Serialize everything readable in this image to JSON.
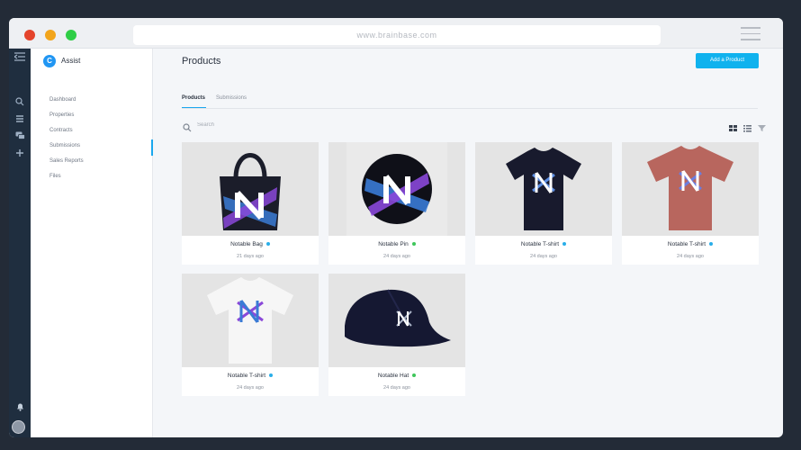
{
  "browser": {
    "url": "www.brainbase.com"
  },
  "app": {
    "name": "Assist",
    "logo_letter": "C"
  },
  "sidebar": {
    "items": [
      {
        "label": "Dashboard"
      },
      {
        "label": "Properties"
      },
      {
        "label": "Contracts"
      },
      {
        "label": "Submissions",
        "active": true
      },
      {
        "label": "Sales Reports"
      },
      {
        "label": "Files"
      }
    ]
  },
  "header": {
    "title": "Products",
    "add_button_label": "Add a Product"
  },
  "tabs": [
    {
      "label": "Products",
      "active": true
    },
    {
      "label": "Submissions",
      "active": false
    }
  ],
  "search": {
    "placeholder": "Search"
  },
  "colors": {
    "accent": "#10b2ee",
    "status_blue": "#29aee8",
    "status_green": "#3ec65a"
  },
  "products": [
    {
      "name": "Notable Bag",
      "time": "21 days ago",
      "status": "blue",
      "image": "tote-bag-icon"
    },
    {
      "name": "Notable Pin",
      "time": "24 days ago",
      "status": "green",
      "image": "pin-badge-icon"
    },
    {
      "name": "Notable T-shirt",
      "time": "24 days ago",
      "status": "blue",
      "image": "navy-tshirt-icon"
    },
    {
      "name": "Notable T-shirt",
      "time": "24 days ago",
      "status": "blue",
      "image": "red-tshirt-icon"
    },
    {
      "name": "Notable T-shirt",
      "time": "24 days ago",
      "status": "blue",
      "image": "white-tshirt-icon"
    },
    {
      "name": "Notable Hat",
      "time": "24 days ago",
      "status": "green",
      "image": "cap-icon"
    }
  ]
}
